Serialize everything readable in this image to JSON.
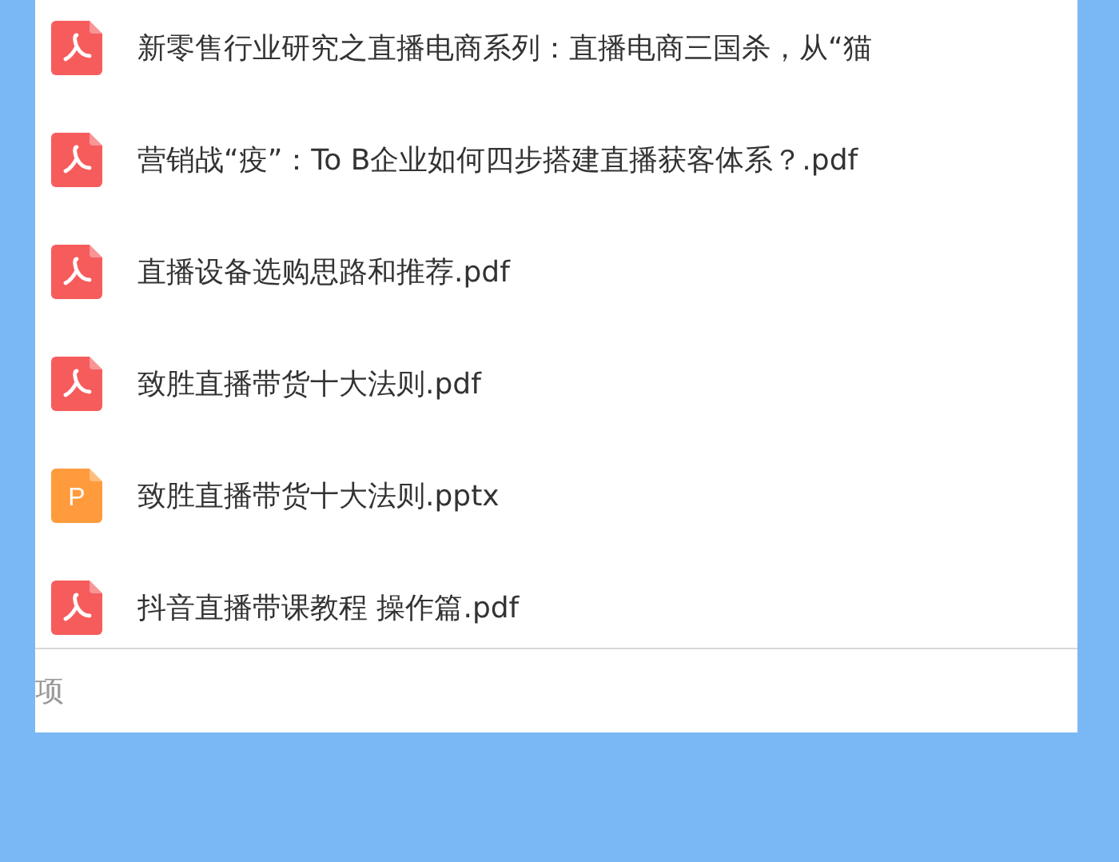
{
  "files": [
    {
      "kind": "pdf",
      "name": "新零售行业研究之直播电商系列：直播电商三国杀，从“猫"
    },
    {
      "kind": "pdf",
      "name": "营销战“疫”：To B企业如何四步搭建直播获客体系？.pdf"
    },
    {
      "kind": "pdf",
      "name": "直播设备选购思路和推荐.pdf"
    },
    {
      "kind": "pdf",
      "name": "致胜直播带货十大法则.pdf"
    },
    {
      "kind": "pptx",
      "badge": "P",
      "name": "致胜直播带货十大法则.pptx"
    },
    {
      "kind": "pdf",
      "name": "抖音直播带课教程 操作篇.pdf"
    }
  ],
  "footer": {
    "text": "项"
  }
}
